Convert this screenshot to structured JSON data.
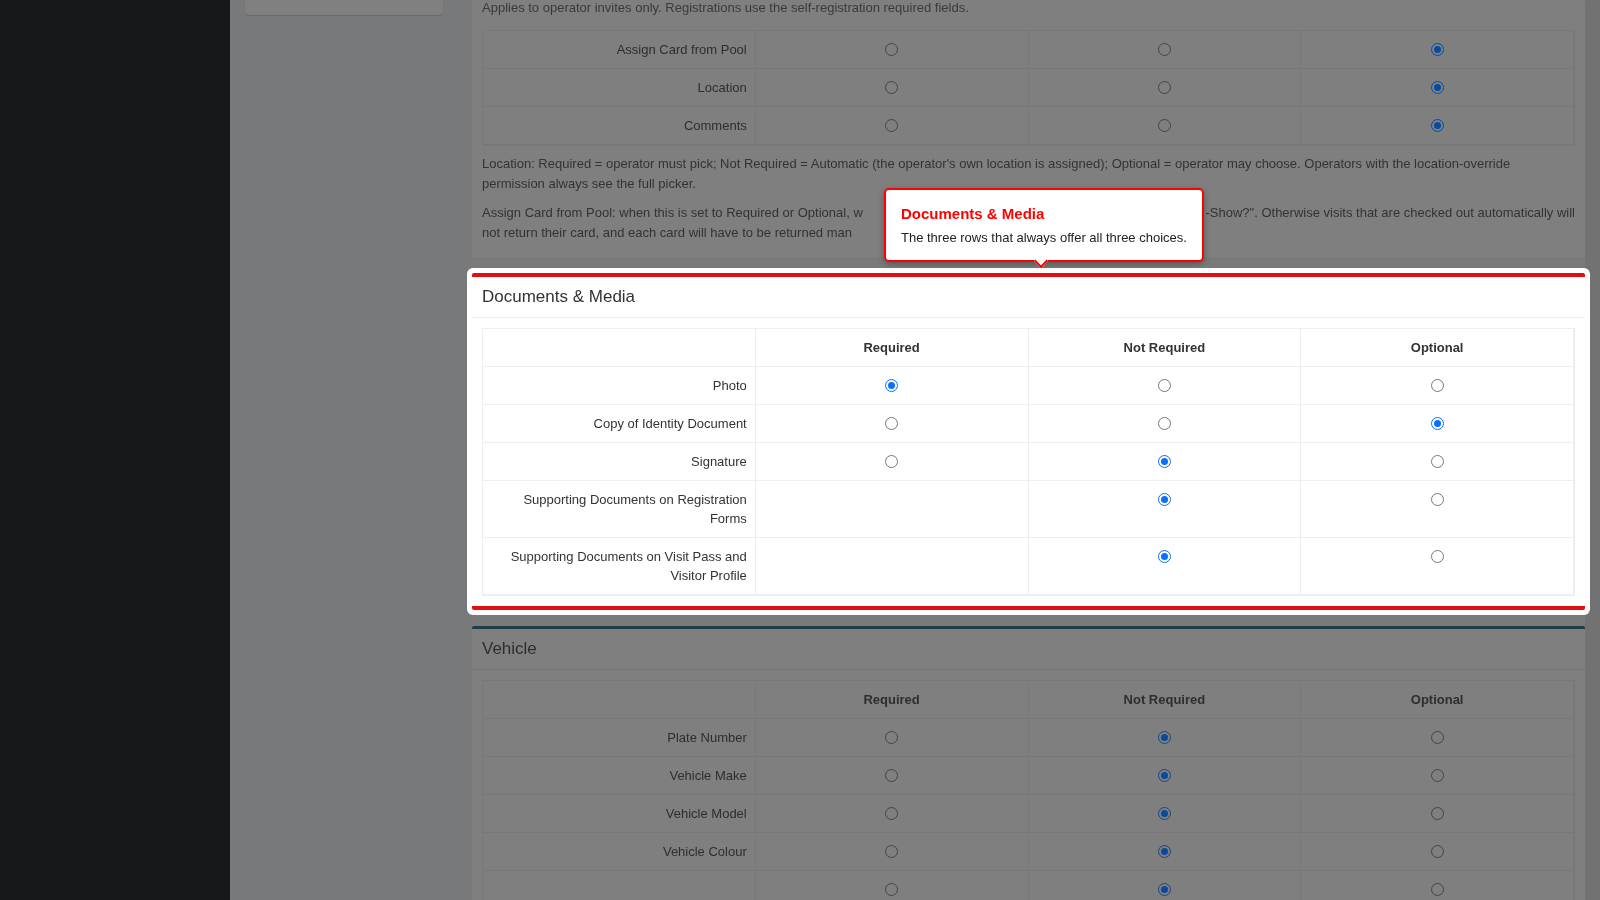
{
  "sections": [
    {
      "highlighted": false,
      "intro": "Applies to operator invites only. Registrations use the self-registration required fields.",
      "rows": [
        {
          "label": "Assign Card from Pool",
          "options": [
            {
              "kind": "radio",
              "selected": false
            },
            {
              "kind": "radio",
              "selected": false
            },
            {
              "kind": "radio",
              "selected": true
            }
          ]
        },
        {
          "label": "Location",
          "options": [
            {
              "kind": "radio",
              "selected": false
            },
            {
              "kind": "radio",
              "selected": false
            },
            {
              "kind": "radio",
              "selected": true
            }
          ]
        },
        {
          "label": "Comments",
          "options": [
            {
              "kind": "radio",
              "selected": false
            },
            {
              "kind": "radio",
              "selected": false
            },
            {
              "kind": "radio",
              "selected": true
            }
          ]
        }
      ],
      "notes": [
        "Location: Required = operator must pick; Not Required = Automatic (the operator's own location is assigned); Optional = operator may choose. Operators with the location-override permission always see the full picker."
      ],
      "covered_note": {
        "line_1_left": "Assign Card from Pool: when this is set to Required or Optional, w",
        "line_1_right": "-Show?\". Otherwise visits that are checked out automatically will",
        "line_2_left": "not return their card, and each card will have to be returned man"
      }
    },
    {
      "highlighted": true,
      "title": "Documents & Media",
      "columns": [
        "Required",
        "Not Required",
        "Optional"
      ],
      "rows": [
        {
          "label": "Photo",
          "options": [
            {
              "kind": "radio",
              "selected": true
            },
            {
              "kind": "radio",
              "selected": false
            },
            {
              "kind": "radio",
              "selected": false
            }
          ]
        },
        {
          "label": "Copy of Identity Document",
          "options": [
            {
              "kind": "radio",
              "selected": false
            },
            {
              "kind": "radio",
              "selected": false
            },
            {
              "kind": "radio",
              "selected": true
            }
          ]
        },
        {
          "label": "Signature",
          "options": [
            {
              "kind": "radio",
              "selected": false
            },
            {
              "kind": "radio",
              "selected": true
            },
            {
              "kind": "radio",
              "selected": false
            }
          ]
        },
        {
          "label": "Supporting Documents on Registration Forms",
          "options": [
            {
              "kind": "blank"
            },
            {
              "kind": "radio",
              "selected": true
            },
            {
              "kind": "radio",
              "selected": false
            }
          ]
        },
        {
          "label": "Supporting Documents on Visit Pass and Visitor Profile",
          "options": [
            {
              "kind": "blank"
            },
            {
              "kind": "radio",
              "selected": true
            },
            {
              "kind": "radio",
              "selected": false
            }
          ]
        }
      ]
    },
    {
      "highlighted": false,
      "title": "Vehicle",
      "columns": [
        "Required",
        "Not Required",
        "Optional"
      ],
      "rows": [
        {
          "label": "Plate Number",
          "options": [
            {
              "kind": "radio",
              "selected": false
            },
            {
              "kind": "radio",
              "selected": true
            },
            {
              "kind": "radio",
              "selected": false
            }
          ]
        },
        {
          "label": "Vehicle Make",
          "options": [
            {
              "kind": "radio",
              "selected": false
            },
            {
              "kind": "radio",
              "selected": true
            },
            {
              "kind": "radio",
              "selected": false
            }
          ]
        },
        {
          "label": "Vehicle Model",
          "options": [
            {
              "kind": "radio",
              "selected": false
            },
            {
              "kind": "radio",
              "selected": true
            },
            {
              "kind": "radio",
              "selected": false
            }
          ]
        },
        {
          "label": "Vehicle Colour",
          "options": [
            {
              "kind": "radio",
              "selected": false
            },
            {
              "kind": "radio",
              "selected": true
            },
            {
              "kind": "radio",
              "selected": false
            }
          ]
        },
        {
          "options": [
            {
              "kind": "radio",
              "selected": false
            },
            {
              "kind": "radio",
              "selected": true
            },
            {
              "kind": "radio",
              "selected": false
            }
          ]
        }
      ]
    }
  ],
  "tooltip": {
    "title": "Documents & Media",
    "text": "The three rows that always offer all three choices."
  }
}
